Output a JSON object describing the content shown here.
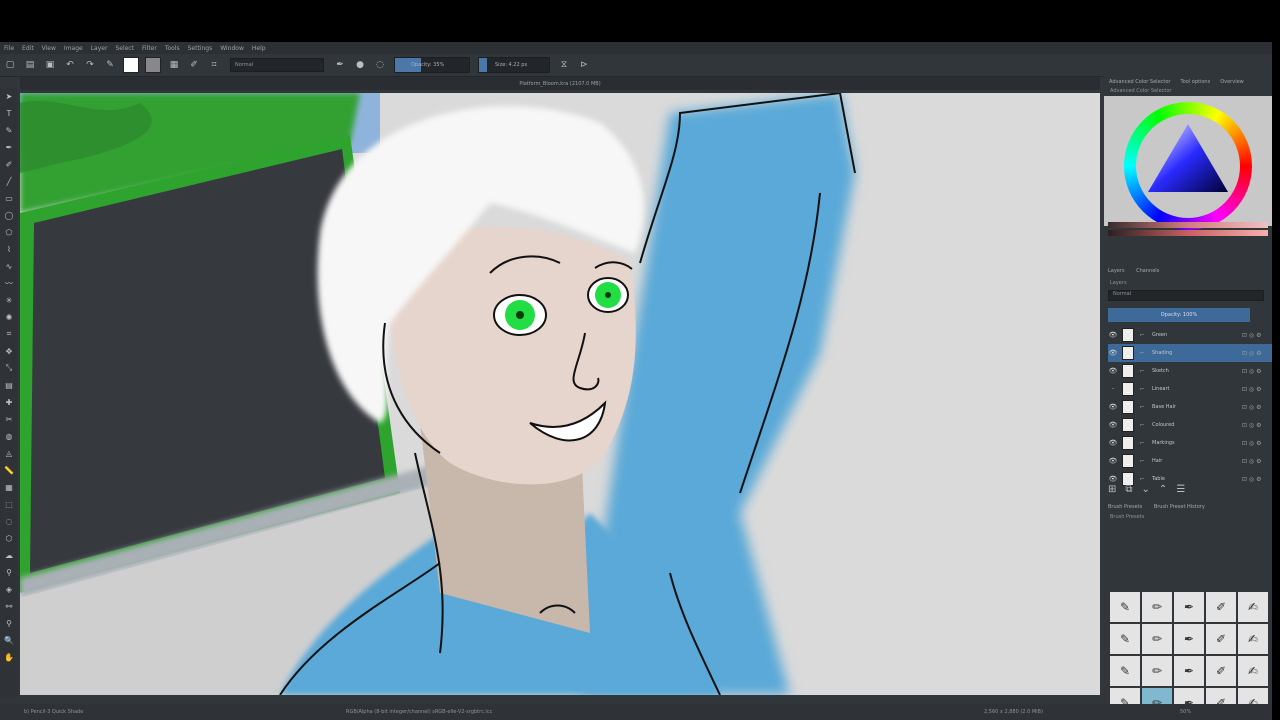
{
  "menu": [
    "File",
    "Edit",
    "View",
    "Image",
    "Layer",
    "Select",
    "Filter",
    "Tools",
    "Settings",
    "Window",
    "Help"
  ],
  "toolbar": {
    "blend_mode": "Normal",
    "opacity_label": "Opacity: 35%",
    "opacity_value": 0.35,
    "size_label": "Size: 4.22 px",
    "foreground_color": "#ffffff",
    "background_color": "#888888"
  },
  "document": {
    "tab_title": "Platform_Bloom.kra (2107.0 MB)"
  },
  "tools": [
    "select-icon",
    "text-icon",
    "shape-edit-icon",
    "calligraphy-icon",
    "brush-icon",
    "line-icon",
    "rectangle-icon",
    "ellipse-icon",
    "polygon-icon",
    "polyline-icon",
    "bezier-icon",
    "freehand-path-icon",
    "dynamic-brush-icon",
    "multibrush-icon",
    "crop-icon",
    "move-icon",
    "transform-icon",
    "gradient-icon",
    "color-picker-icon",
    "patch-icon",
    "fill-icon",
    "assistant-icon",
    "measure-icon",
    "reference-icon",
    "rect-select-icon",
    "ellipse-select-icon",
    "polygon-select-icon",
    "freehand-select-icon",
    "contiguous-select-icon",
    "similar-select-icon",
    "bezier-select-icon",
    "magnetic-select-icon",
    "zoom-icon",
    "pan-icon"
  ],
  "docker": {
    "tabs": [
      "Advanced Color Selector",
      "Tool options",
      "Overview"
    ],
    "color_title": "Advanced Color Selector",
    "sub_tabs": [
      "Layers",
      "Channels"
    ],
    "layers_title": "Layers",
    "blend_mode": "Normal",
    "opacity": "Opacity: 100%",
    "layers": [
      {
        "name": "Green",
        "visible": true,
        "active": false
      },
      {
        "name": "Shading",
        "visible": true,
        "active": true
      },
      {
        "name": "Sketch",
        "visible": true,
        "active": false
      },
      {
        "name": "Lineart",
        "visible": false,
        "active": false
      },
      {
        "name": "Base Hair",
        "visible": true,
        "active": false
      },
      {
        "name": "Coloured",
        "visible": true,
        "active": false
      },
      {
        "name": "Markings",
        "visible": true,
        "active": false
      },
      {
        "name": "Hair",
        "visible": true,
        "active": false
      },
      {
        "name": "Table",
        "visible": true,
        "active": false
      }
    ],
    "brush_tabs": [
      "Brush Presets",
      "Brush Preset History"
    ],
    "brush_title": "Brush Presets"
  },
  "status": {
    "brush": "b) Pencil-3 Quick Shade",
    "color_space": "RGB/Alpha (8-bit integer/channel)  sRGB-elle-V2-srgbtrc.icc",
    "dimensions": "2,560 x 2,880 (2.0 MiB)",
    "zoom": "50%"
  }
}
